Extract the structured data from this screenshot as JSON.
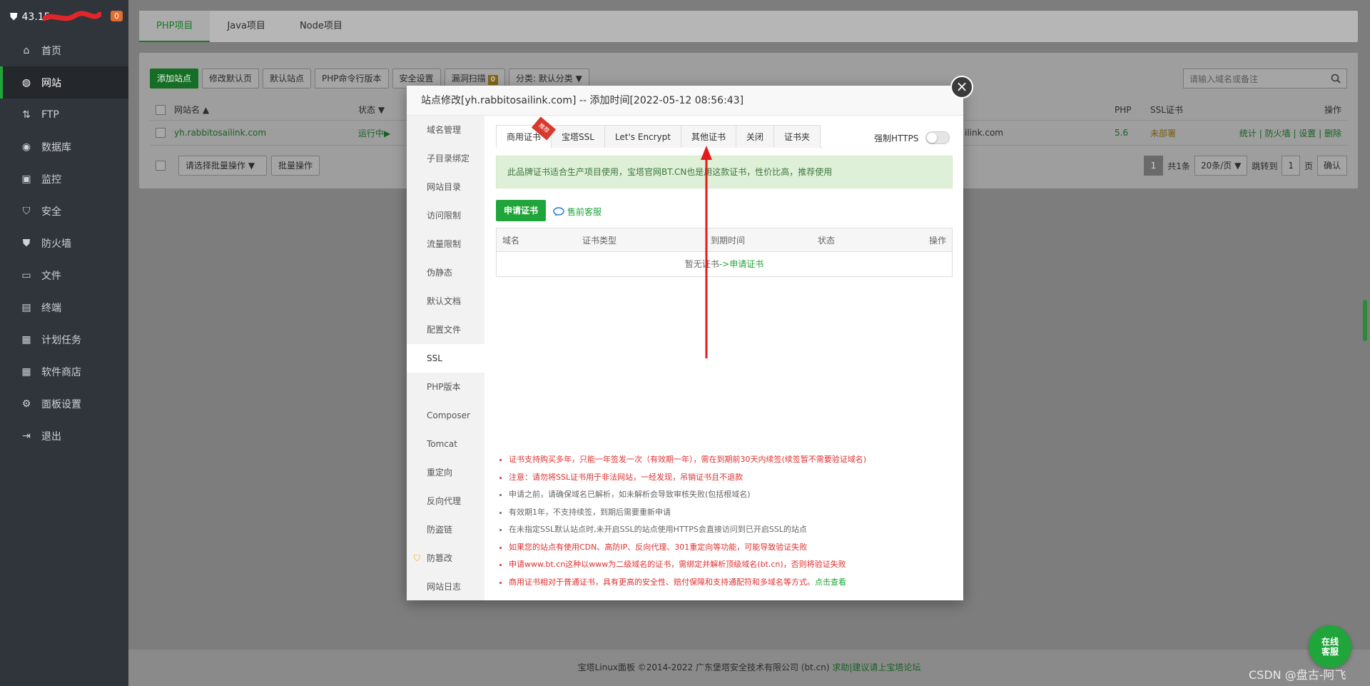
{
  "sidebar": {
    "server_label": "43.15",
    "notice_count": "0",
    "items": [
      {
        "label": "首页",
        "icon": "home-icon"
      },
      {
        "label": "网站",
        "icon": "globe-icon",
        "active": true
      },
      {
        "label": "FTP",
        "icon": "ftp-icon"
      },
      {
        "label": "数据库",
        "icon": "database-icon"
      },
      {
        "label": "监控",
        "icon": "monitor-icon"
      },
      {
        "label": "安全",
        "icon": "shield-icon"
      },
      {
        "label": "防火墙",
        "icon": "firewall-icon"
      },
      {
        "label": "文件",
        "icon": "folder-icon"
      },
      {
        "label": "终端",
        "icon": "terminal-icon"
      },
      {
        "label": "计划任务",
        "icon": "calendar-icon"
      },
      {
        "label": "软件商店",
        "icon": "grid-icon"
      },
      {
        "label": "面板设置",
        "icon": "settings-icon"
      },
      {
        "label": "退出",
        "icon": "logout-icon"
      }
    ]
  },
  "project_tabs": [
    "PHP项目",
    "Java项目",
    "Node项目"
  ],
  "toolbar": {
    "add_site": "添加站点",
    "edit_default_page": "修改默认页",
    "default_site": "默认站点",
    "php_cli": "PHP命令行版本",
    "security": "安全设置",
    "vuln_scan": "漏洞扫描",
    "vuln_count": "0",
    "category": "分类: 默认分类",
    "search_placeholder": "请输入域名或备注"
  },
  "table": {
    "headers": {
      "name": "网站名",
      "status": "状态",
      "php": "PHP",
      "ssl": "SSL证书",
      "ops": "操作"
    },
    "row": {
      "name": "yh.rabbitosailink.com",
      "status": "运行中",
      "domain_tail": "ilink.com",
      "php": "5.6",
      "ssl": "未部署",
      "ops": [
        "统计",
        "防火墙",
        "设置",
        "删除"
      ]
    }
  },
  "batch": {
    "select_placeholder": "请选择批量操作",
    "batch_button": "批量操作"
  },
  "pager": {
    "current": "1",
    "total": "共1条",
    "per_page": "20条/页",
    "goto_label": "跳转到",
    "goto_value": "1",
    "page_unit": "页",
    "confirm": "确认"
  },
  "footer": {
    "copyright": "宝塔Linux面板 ©2014-2022 广东堡塔安全技术有限公司 (bt.cn)",
    "help": "求助|建议请上宝塔论坛"
  },
  "online_service": "在线\n客服",
  "watermark": "CSDN @盘古-阿飞",
  "modal": {
    "title": "站点修改[yh.rabbitosailink.com] -- 添加时间[2022-05-12 08:56:43]",
    "side_items": [
      "域名管理",
      "子目录绑定",
      "网站目录",
      "访问限制",
      "流量限制",
      "伪静态",
      "默认文档",
      "配置文件",
      "SSL",
      "PHP版本",
      "Composer",
      "Tomcat",
      "重定向",
      "反向代理",
      "防盗链",
      "防篡改",
      "网站日志"
    ],
    "ssl_tabs": [
      "商用证书",
      "宝塔SSL",
      "Let's Encrypt",
      "其他证书",
      "关闭",
      "证书夹"
    ],
    "recommend_ribbon": "推荐",
    "force_https": "强制HTTPS",
    "notice": "此品牌证书适合生产项目使用，宝塔官网BT.CN也是用这款证书，性价比高，推荐使用",
    "apply_button": "申请证书",
    "presale": "售前客服",
    "cert_table": {
      "headers": [
        "域名",
        "证书类型",
        "到期时间",
        "状态",
        "操作"
      ],
      "empty_text": "暂无证书",
      "empty_link": "->申请证书"
    },
    "tips": [
      {
        "text": "证书支持购买多年，只能一年签发一次（有效期一年），需在到期前30天内续签(续签暂不需要验证域名)",
        "color": "red"
      },
      {
        "text": "注意：请勿将SSL证书用于非法网站，一经发现，吊销证书且不退款",
        "color": "red"
      },
      {
        "text": "申请之前，请确保域名已解析，如未解析会导致审核失败(包括根域名)",
        "color": "gray"
      },
      {
        "text": "有效期1年，不支持续签，到期后需要重新申请",
        "color": "gray"
      },
      {
        "text": "在未指定SSL默认站点时,未开启SSL的站点使用HTTPS会直接访问到已开启SSL的站点",
        "color": "gray"
      },
      {
        "text": "如果您的站点有使用CDN、高防IP、反向代理、301重定向等功能，可能导致验证失败",
        "color": "red"
      },
      {
        "text": "申请www.bt.cn这种以www为二级域名的证书，需绑定并解析顶级域名(bt.cn)，否则将验证失败",
        "color": "red"
      },
      {
        "text": "商用证书相对于普通证书，具有更高的安全性、赔付保障和支持通配符和多域名等方式。",
        "color": "red",
        "link": "点击查看"
      }
    ]
  },
  "colors": {
    "accent": "#20a53a",
    "sidebar_bg": "#30343b",
    "danger": "#e12f2f"
  }
}
